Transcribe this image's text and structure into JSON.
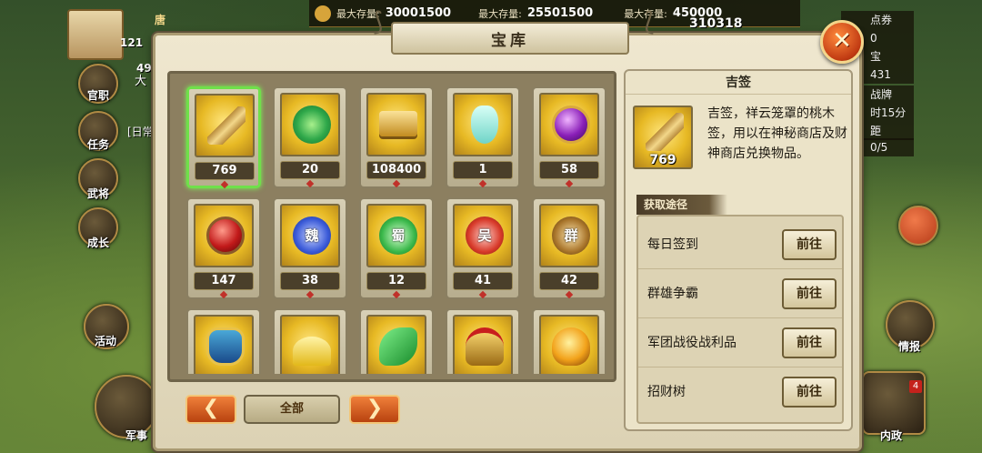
{
  "hud": {
    "player_name": "唐",
    "level": "121",
    "stat_1": "49",
    "resources": [
      {
        "label": "最大存量:",
        "value": "30001500"
      },
      {
        "label": "最大存量:",
        "value": "25501500"
      },
      {
        "label": "最大存量:",
        "value": "450000"
      }
    ],
    "silver": "310318",
    "right_items": [
      "点券",
      "0",
      "宝",
      "431",
      "战牌",
      "时15分钟",
      "0/5",
      "距"
    ],
    "left_menu": [
      "官职",
      "任务",
      "武将",
      "成长",
      "活动",
      "军事"
    ],
    "left_text": [
      "大",
      "[日常"
    ],
    "right_menu": [
      "情报",
      "内政"
    ],
    "domestic_badge": "4"
  },
  "panel": {
    "title": "宝库",
    "close_icon": "close-x-icon"
  },
  "items": [
    {
      "name": "吉签",
      "qty": "769",
      "icon": "token-stick-icon",
      "selected": true
    },
    {
      "name": "",
      "qty": "20",
      "icon": "jade-disc-icon"
    },
    {
      "name": "",
      "qty": "108400",
      "icon": "gold-ingot-icon"
    },
    {
      "name": "",
      "qty": "1",
      "icon": "vase-icon"
    },
    {
      "name": "",
      "qty": "58",
      "icon": "purple-gem-icon"
    },
    {
      "name": "",
      "qty": "147",
      "icon": "red-gem-icon"
    },
    {
      "name": "",
      "qty": "38",
      "icon": "wei-seal-icon",
      "glyph": "魏"
    },
    {
      "name": "",
      "qty": "12",
      "icon": "shu-seal-icon",
      "glyph": "蜀"
    },
    {
      "name": "",
      "qty": "41",
      "icon": "wu-seal-icon",
      "glyph": "吴"
    },
    {
      "name": "",
      "qty": "42",
      "icon": "qun-seal-icon",
      "glyph": "群"
    },
    {
      "name": "",
      "qty": "",
      "icon": "treasure-pot-icon"
    },
    {
      "name": "",
      "qty": "",
      "icon": "gold-pile-icon"
    },
    {
      "name": "",
      "qty": "",
      "icon": "jade-pendant-icon"
    },
    {
      "name": "",
      "qty": "",
      "icon": "helmet-icon"
    },
    {
      "name": "",
      "qty": "",
      "icon": "amber-crystal-icon"
    }
  ],
  "pager": {
    "prev": "❮",
    "next": "❯",
    "filter": "全部"
  },
  "detail": {
    "title": "吉签",
    "qty": "769",
    "description": "吉签，祥云笼罩的桃木签，用以在神秘商店及财神商店兑换物品。",
    "acquire_label": "获取途径",
    "sources": [
      {
        "name": "每日签到",
        "button": "前往"
      },
      {
        "name": "群雄争霸",
        "button": "前往"
      },
      {
        "name": "军团战役战利品",
        "button": "前往"
      },
      {
        "name": "招财树",
        "button": "前往"
      }
    ]
  },
  "colors": {
    "slot_gold": "#e7b924",
    "select_green": "#6fe04a",
    "close_orange": "#e85a1c"
  }
}
